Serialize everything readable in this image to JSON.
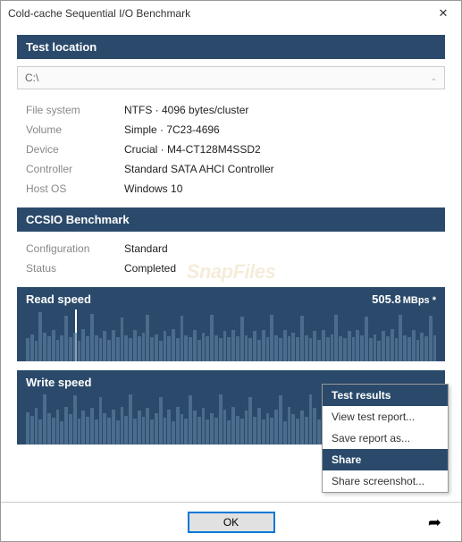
{
  "window": {
    "title": "Cold-cache Sequential I/O Benchmark"
  },
  "sections": {
    "location": {
      "header": "Test location",
      "path": "C:\\"
    },
    "benchmark": {
      "header": "CCSIO Benchmark"
    }
  },
  "location_info": [
    {
      "label": "File system",
      "value": "NTFS  ·  4096 bytes/cluster"
    },
    {
      "label": "Volume",
      "value": "Simple  ·  7C23-4696"
    },
    {
      "label": "Device",
      "value": "Crucial  ·  M4-CT128M4SSD2"
    },
    {
      "label": "Controller",
      "value": "Standard SATA AHCI Controller"
    },
    {
      "label": "Host OS",
      "value": "Windows 10"
    }
  ],
  "benchmark_info": [
    {
      "label": "Configuration",
      "value": "Standard"
    },
    {
      "label": "Status",
      "value": "Completed"
    }
  ],
  "read": {
    "label": "Read speed",
    "value": "505.8",
    "unit": "MBps *"
  },
  "write": {
    "label": "Write speed"
  },
  "chart_data": [
    {
      "type": "bar",
      "title": "Read speed",
      "ylabel": "MBps",
      "ylim": [
        0,
        600
      ],
      "note": "approximate sample heights as fraction of max",
      "values": [
        0.45,
        0.52,
        0.4,
        0.95,
        0.55,
        0.48,
        0.6,
        0.42,
        0.5,
        0.88,
        0.46,
        0.55,
        0.4,
        0.62,
        0.48,
        0.92,
        0.5,
        0.45,
        0.58,
        0.42,
        0.6,
        0.46,
        0.85,
        0.5,
        0.44,
        0.6,
        0.48,
        0.55,
        0.9,
        0.46,
        0.52,
        0.4,
        0.58,
        0.48,
        0.62,
        0.44,
        0.88,
        0.5,
        0.46,
        0.6,
        0.42,
        0.55,
        0.48,
        0.9,
        0.5,
        0.44,
        0.58,
        0.46,
        0.6,
        0.48,
        0.86,
        0.5,
        0.45,
        0.58,
        0.42,
        0.6,
        0.46,
        0.9,
        0.5,
        0.44,
        0.6,
        0.48,
        0.55,
        0.46,
        0.88,
        0.5,
        0.45,
        0.58,
        0.42,
        0.6,
        0.46,
        0.52,
        0.9,
        0.48,
        0.44,
        0.58,
        0.46,
        0.6,
        0.5,
        0.86,
        0.45,
        0.52,
        0.4,
        0.58,
        0.48,
        0.62,
        0.44,
        0.9,
        0.5,
        0.46,
        0.6,
        0.42,
        0.55,
        0.48,
        0.88,
        0.5
      ]
    },
    {
      "type": "bar",
      "title": "Write speed",
      "ylabel": "MBps",
      "ylim": [
        0,
        600
      ],
      "note": "approximate sample heights as fraction of max",
      "values": [
        0.62,
        0.55,
        0.7,
        0.48,
        0.96,
        0.6,
        0.52,
        0.68,
        0.45,
        0.72,
        0.58,
        0.94,
        0.5,
        0.66,
        0.54,
        0.7,
        0.48,
        0.92,
        0.6,
        0.52,
        0.68,
        0.46,
        0.72,
        0.56,
        0.96,
        0.5,
        0.66,
        0.54,
        0.7,
        0.48,
        0.6,
        0.92,
        0.52,
        0.68,
        0.45,
        0.72,
        0.58,
        0.5,
        0.94,
        0.66,
        0.54,
        0.7,
        0.48,
        0.6,
        0.52,
        0.96,
        0.68,
        0.46,
        0.72,
        0.56,
        0.5,
        0.66,
        0.92,
        0.54,
        0.7,
        0.48,
        0.6,
        0.52,
        0.68,
        0.94,
        0.45,
        0.72,
        0.58,
        0.5,
        0.66,
        0.54,
        0.96,
        0.7,
        0.48,
        0.6,
        0.52,
        0.68,
        0.46,
        0.92,
        0.72,
        0.56,
        0.5,
        0.66,
        0.54,
        0.7,
        0.48,
        0.94,
        0.6,
        0.52,
        0.68,
        0.45,
        0.72,
        0.58,
        0.5,
        0.96,
        0.66,
        0.54,
        0.7,
        0.48,
        0.6,
        0.52
      ]
    }
  ],
  "menu": {
    "h1": "Test results",
    "i1": "View test report...",
    "i2": "Save report as...",
    "h2": "Share",
    "i3": "Share screenshot..."
  },
  "footer": {
    "ok": "OK"
  },
  "watermark": "SnapFiles"
}
